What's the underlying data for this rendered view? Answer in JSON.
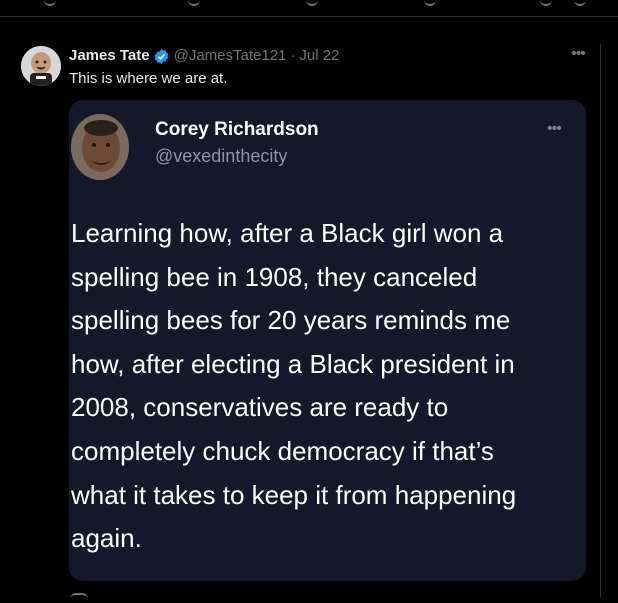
{
  "tweet": {
    "author_name": "James Tate",
    "handle": "@JamesTate121",
    "separator": "·",
    "date": "Jul 22",
    "text": "This is where we are at.",
    "more_icon": "more-icon"
  },
  "quoted_post": {
    "author_name": "Corey Richardson",
    "handle": "@vexedinthecity",
    "lines": [
      "Learning how, after a Black girl won a",
      "spelling bee in 1908, they canceled",
      "spelling bees for 20 years reminds me",
      "how, after electing a Black president in",
      "2008, conservatives are ready to",
      "completely chuck democracy if that’s",
      "what it takes to keep it from happening",
      "again."
    ]
  },
  "colors": {
    "background": "#000000",
    "text": "#e7e9ea",
    "muted": "#71767b",
    "verified": "#1d9bf0",
    "card": "#15172a"
  }
}
